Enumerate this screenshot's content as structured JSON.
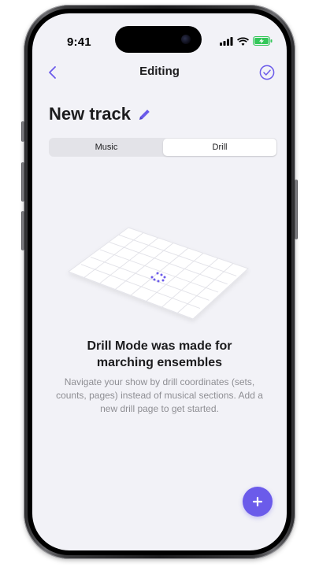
{
  "status_bar": {
    "time": "9:41"
  },
  "nav": {
    "title": "Editing",
    "back_icon": "chevron-left-icon",
    "done_icon": "checkmark-circle-icon"
  },
  "track": {
    "title": "New track",
    "edit_icon": "pencil-icon"
  },
  "segmented_control": {
    "options": [
      "Music",
      "Drill"
    ],
    "selected": "Drill"
  },
  "empty_state": {
    "heading_line1": "Drill Mode was made for",
    "heading_line2": "marching ensembles",
    "body": "Navigate your show by drill coordinates (sets, counts, pages) instead of musical sections. Add a new drill page to get started."
  },
  "fab": {
    "icon": "plus-icon"
  },
  "colors": {
    "accent": "#6b5bea",
    "background": "#f2f2f7",
    "text_primary": "#1c1c1e",
    "text_secondary": "#8e8e93"
  }
}
